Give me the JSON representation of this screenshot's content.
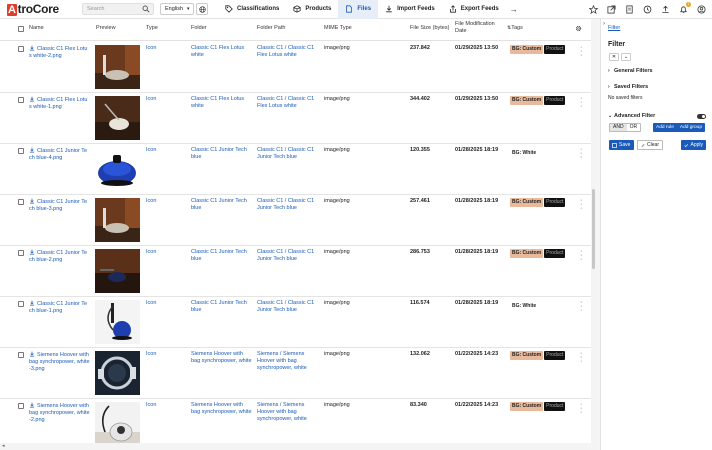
{
  "app": {
    "logo_first": "A",
    "logo_rest": "troCore"
  },
  "search": {
    "placeholder": "Search"
  },
  "language": {
    "selected": "English"
  },
  "nav": [
    {
      "label": "Classifications",
      "icon": "tag-icon"
    },
    {
      "label": "Products",
      "icon": "box-icon"
    },
    {
      "label": "Files",
      "icon": "file-icon",
      "active": true
    },
    {
      "label": "Import Feeds",
      "icon": "download-icon"
    },
    {
      "label": "Export Feeds",
      "icon": "upload-icon"
    }
  ],
  "notifications": {
    "count": "1"
  },
  "columns": {
    "name": "Name",
    "preview": "Preview",
    "type": "Type",
    "folder": "Folder",
    "folder_path": "Folder Path",
    "mime": "MIME Type",
    "size": "File Size (bytes)",
    "mod_date": "File Modification Date",
    "tags": "Tags"
  },
  "rows": [
    {
      "name": "Classic C1 Flex Lotus white-2.png",
      "name_l1": "Classic C1 Flex Lotu",
      "name_l2": "s white-2.png",
      "type": "Icon",
      "folder_l1": "Classic C1 Flex Lotus",
      "folder_l2": "white",
      "path_l1": "Classic C1 / Classic C1",
      "path_l2": "Flex Lotus white",
      "mime": "image/png",
      "size": "237.842",
      "date": "01/29/2025 13:50",
      "tag": "BG: Custom",
      "tag2": "Product",
      "img": "vacuum-orange"
    },
    {
      "name": "Classic C1 Flex Lotus white-1.png",
      "name_l1": "Classic C1 Flex Lotu",
      "name_l2": "s white-1.png",
      "type": "Icon",
      "folder_l1": "Classic C1 Flex Lotus",
      "folder_l2": "white",
      "path_l1": "Classic C1 / Classic C1",
      "path_l2": "Flex Lotus white",
      "mime": "image/png",
      "size": "344.402",
      "date": "01/29/2025 13:50",
      "tag": "BG: Custom",
      "tag2": "Product",
      "img": "vacuum-white-room"
    },
    {
      "name": "Classic C1 Junior Tech blue-4.png",
      "name_l1": "Classic C1 Junior Te",
      "name_l2": "ch blue-4.png",
      "type": "Icon",
      "folder_l1": "Classic C1 Junior Tech",
      "folder_l2": "blue",
      "path_l1": "Classic C1 / Classic C1",
      "path_l2": "Junior Tech blue",
      "mime": "image/png",
      "size": "120.355",
      "date": "01/28/2025 18:19",
      "tag": "BG: White",
      "tag2": "",
      "img": "vacuum-blue"
    },
    {
      "name": "Classic C1 Junior Tech blue-3.png",
      "name_l1": "Classic C1 Junior Te",
      "name_l2": "ch blue-3.png",
      "type": "Icon",
      "folder_l1": "Classic C1 Junior Tech",
      "folder_l2": "blue",
      "path_l1": "Classic C1 / Classic C1",
      "path_l2": "Junior Tech blue",
      "mime": "image/png",
      "size": "257.461",
      "date": "01/28/2025 18:19",
      "tag": "BG: Custom",
      "tag2": "Product",
      "img": "vacuum-orange"
    },
    {
      "name": "Classic C1 Junior Tech blue-2.png",
      "name_l1": "Classic C1 Junior Te",
      "name_l2": "ch blue-2.png",
      "type": "Icon",
      "folder_l1": "Classic C1 Junior Tech",
      "folder_l2": "blue",
      "path_l1": "Classic C1 / Classic C1",
      "path_l2": "Junior Tech blue",
      "mime": "image/png",
      "size": "286.753",
      "date": "01/28/2025 18:19",
      "tag": "BG: Custom",
      "tag2": "Product",
      "img": "vacuum-dark-room"
    },
    {
      "name": "Classic C1 Junior Tech blue-1.png",
      "name_l1": "Classic C1 Junior Te",
      "name_l2": "ch blue-1.png",
      "type": "Icon",
      "folder_l1": "Classic C1 Junior Tech",
      "folder_l2": "blue",
      "path_l1": "Classic C1 / Classic C1",
      "path_l2": "Junior Tech blue",
      "mime": "image/png",
      "size": "116.574",
      "date": "01/28/2025 18:19",
      "tag": "BG: White",
      "tag2": "",
      "img": "vacuum-blue-upright"
    },
    {
      "name": "Siemens Hoover with bag synchropower, white-3.png",
      "name_l1": "Siemens Hoover with",
      "name_l2": "bag synchropower, white",
      "name_l3": "-3.png",
      "type": "Icon",
      "folder_l1": "Siemens Hoover with",
      "folder_l2": "bag synchropower, white",
      "path_l1": "Siemens / Siemens",
      "path_l2": "Hoover with bag",
      "path_l3": "synchropower, white",
      "mime": "image/png",
      "size": "132.062",
      "date": "01/22/2025 14:23",
      "tag": "BG: Custom",
      "tag2": "Product",
      "img": "vacuum-siemens"
    },
    {
      "name": "Siemens Hoover with bag synchropower, white-2.png",
      "name_l1": "Siemens Hoover with",
      "name_l2": "bag synchropower, white",
      "name_l3": "-2.png",
      "type": "Icon",
      "folder_l1": "Siemens Hoover with",
      "folder_l2": "bag synchropower, white",
      "path_l1": "Siemens / Siemens",
      "path_l2": "Hoover with bag",
      "path_l3": "synchropower, white",
      "mime": "image/png",
      "size": "83.340",
      "date": "01/22/2025 14:23",
      "tag": "BG: Custom",
      "tag2": "Product",
      "img": "vacuum-siemens-room"
    }
  ],
  "panel": {
    "filter_link": "Filter",
    "title": "Filter",
    "general_filters": "General Filters",
    "saved_filters": "Saved Filters",
    "no_saved": "No saved filters",
    "advanced_filter": "Advanced Filter",
    "and": "AND",
    "or": "OR",
    "add_rule": "Add rule",
    "add_group": "Add group",
    "save": "Save",
    "clear": "Clear",
    "apply": "Apply"
  },
  "colors": {
    "accent": "#1a5ab8",
    "tag_custom": "#e8b99a",
    "logo_red": "#e23c2c"
  }
}
